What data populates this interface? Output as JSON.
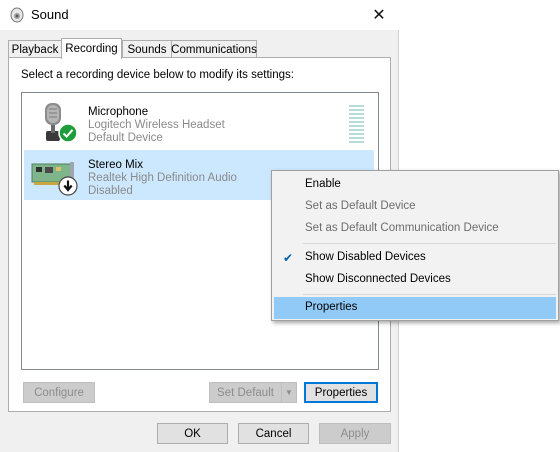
{
  "window": {
    "title": "Sound",
    "close_glyph": "✕"
  },
  "tabs": [
    {
      "label": "Playback",
      "active": false
    },
    {
      "label": "Recording",
      "active": true
    },
    {
      "label": "Sounds",
      "active": false
    },
    {
      "label": "Communications",
      "active": false
    }
  ],
  "instruction": "Select a recording device below to modify its settings:",
  "devices": [
    {
      "name": "Microphone",
      "description": "Logitech Wireless Headset",
      "status": "Default Device",
      "icon": "microphone-icon",
      "badge": "green-check-badge",
      "selected": false
    },
    {
      "name": "Stereo Mix",
      "description": "Realtek High Definition Audio",
      "status": "Disabled",
      "icon": "sound-card-icon",
      "badge": "disabled-arrow-badge",
      "selected": true
    }
  ],
  "buttons": {
    "configure": "Configure",
    "set_default": "Set Default",
    "properties": "Properties",
    "ok": "OK",
    "cancel": "Cancel",
    "apply": "Apply"
  },
  "context_menu": {
    "items": [
      {
        "label": "Enable",
        "enabled": true,
        "checked": false
      },
      {
        "label": "Set as Default Device",
        "enabled": false,
        "checked": false
      },
      {
        "label": "Set as Default Communication Device",
        "enabled": false,
        "checked": false
      },
      {
        "label": "Show Disabled Devices",
        "enabled": true,
        "checked": true
      },
      {
        "label": "Show Disconnected Devices",
        "enabled": true,
        "checked": false
      },
      {
        "label": "Properties",
        "enabled": true,
        "checked": false,
        "highlighted": true
      }
    ]
  },
  "colors": {
    "selection": "#cce8ff",
    "menu_highlight": "#91c9f7",
    "accent": "#0078d7",
    "check_green": "#1e9e3a"
  }
}
